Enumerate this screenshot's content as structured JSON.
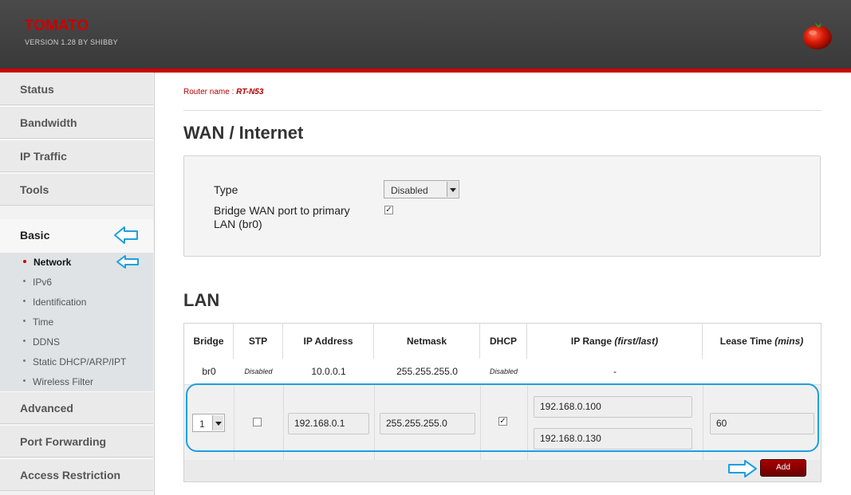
{
  "header": {
    "title": "TOMATO",
    "version": "VERSION 1.28 BY SHIBBY",
    "accent_color": "#cc0000",
    "logo_icon": "tomato-icon"
  },
  "sidebar": {
    "items_top": [
      {
        "label": "Status"
      },
      {
        "label": "Bandwidth"
      },
      {
        "label": "IP Traffic"
      },
      {
        "label": "Tools"
      }
    ],
    "active_section": "Basic",
    "subitems": [
      {
        "label": "Network",
        "active": true
      },
      {
        "label": "IPv6"
      },
      {
        "label": "Identification"
      },
      {
        "label": "Time"
      },
      {
        "label": "DDNS"
      },
      {
        "label": "Static DHCP/ARP/IPT"
      },
      {
        "label": "Wireless Filter"
      }
    ],
    "items_bottom": [
      {
        "label": "Advanced"
      },
      {
        "label": "Port Forwarding"
      },
      {
        "label": "Access Restriction"
      }
    ]
  },
  "main": {
    "router_name_label": "Router name :",
    "router_name_value": "RT-N53",
    "wan": {
      "title": "WAN / Internet",
      "type_label": "Type",
      "type_value": "Disabled",
      "bridge_label_line1": "Bridge WAN port to primary",
      "bridge_label_line2": "LAN (br0)",
      "bridge_checked": true
    },
    "lan": {
      "title": "LAN",
      "columns": {
        "bridge": "Bridge",
        "stp": "STP",
        "ip": "IP Address",
        "netmask": "Netmask",
        "dhcp": "DHCP",
        "range": "IP Range",
        "range_note": "(first/last)",
        "lease": "Lease Time",
        "lease_note": "(mins)"
      },
      "row": {
        "bridge": "br0",
        "stp": "Disabled",
        "ip": "10.0.0.1",
        "netmask": "255.255.255.0",
        "dhcp": "Disabled",
        "range": "-"
      },
      "edit": {
        "bridge_value": "1",
        "stp_checked": false,
        "ip": "192.168.0.1",
        "netmask": "255.255.255.0",
        "dhcp_checked": true,
        "range_first": "192.168.0.100",
        "range_last": "192.168.0.130",
        "lease": "60"
      },
      "add_label": "Add"
    }
  },
  "highlight_color": "#1e9fe0"
}
